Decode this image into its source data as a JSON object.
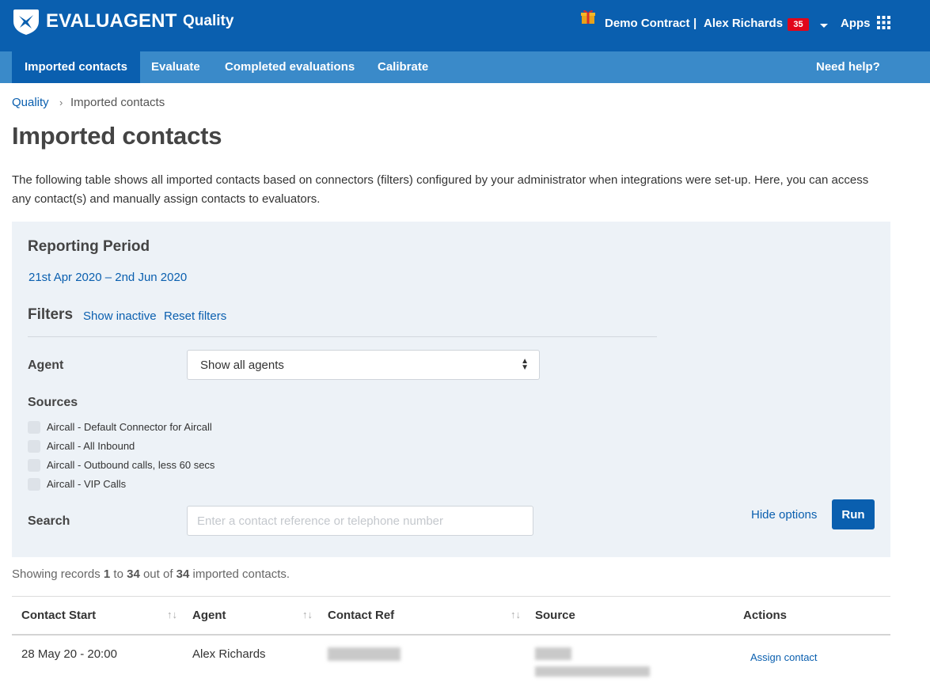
{
  "header": {
    "brand": "EVALUAGENT",
    "product": "Quality",
    "contract": "Demo Contract",
    "separator": "|",
    "user": "Alex Richards",
    "notification_count": "35",
    "apps_label": "Apps",
    "brand_color": "#0a5faf",
    "badge_color": "#e1061a"
  },
  "nav": {
    "tabs": [
      {
        "label": "Imported contacts",
        "active": true
      },
      {
        "label": "Evaluate",
        "active": false
      },
      {
        "label": "Completed evaluations",
        "active": false
      },
      {
        "label": "Calibrate",
        "active": false
      }
    ],
    "help_label": "Need help?"
  },
  "breadcrumb": {
    "parent": "Quality",
    "separator": "›",
    "current": "Imported contacts"
  },
  "page": {
    "title": "Imported contacts",
    "intro": "The following table shows all imported contacts based on connectors (filters) configured by your administrator when integrations were set-up. Here, you can access any contact(s) and manually assign contacts to evaluators."
  },
  "filters": {
    "reporting_period_title": "Reporting Period",
    "reporting_period_value": "21st Apr 2020 – 2nd Jun 2020",
    "filters_title": "Filters",
    "show_inactive": "Show inactive",
    "reset_filters": "Reset filters",
    "agent_label": "Agent",
    "agent_selected": "Show all agents",
    "sources_label": "Sources",
    "sources": [
      {
        "label": "Aircall - Default Connector for Aircall",
        "checked": false
      },
      {
        "label": "Aircall - All Inbound",
        "checked": false
      },
      {
        "label": "Aircall - Outbound calls, less 60 secs",
        "checked": false
      },
      {
        "label": "Aircall - VIP Calls",
        "checked": false
      }
    ],
    "search_label": "Search",
    "search_placeholder": "Enter a contact reference or telephone number",
    "search_value": "",
    "hide_options": "Hide options",
    "run": "Run"
  },
  "records": {
    "prefix": "Showing records",
    "from": "1",
    "to_word": "to",
    "to": "34",
    "out_of_word": "out of",
    "total": "34",
    "suffix": "imported contacts."
  },
  "table": {
    "columns": [
      "Contact Start",
      "Agent",
      "Contact Ref",
      "Source",
      "Actions"
    ],
    "sort_icon": "↑↓",
    "rows": [
      {
        "contact_start": "28 May 20 - 20:00",
        "agent": "Alex Richards",
        "action": "Assign contact"
      }
    ]
  }
}
